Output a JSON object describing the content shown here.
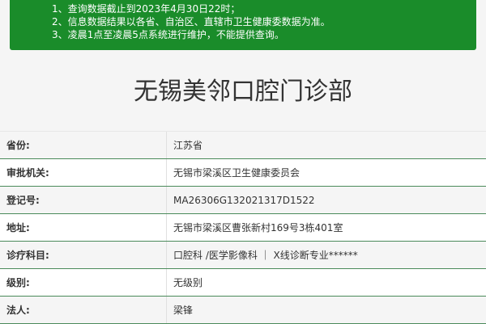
{
  "notice": {
    "lines": [
      "1、查询数据截止到2023年4月30日22时；",
      "2、信息数据结果以各省、自治区、直辖市卫生健康委数据为准。",
      "3、凌晨1点至凌晨5点系统进行维护，不能提供查询。"
    ]
  },
  "title": "无锡美邻口腔门诊部",
  "rows": [
    {
      "label": "省份:",
      "value": "江苏省"
    },
    {
      "label": "审批机关:",
      "value": "无锡市梁溪区卫生健康委员会"
    },
    {
      "label": "登记号:",
      "value": "MA26306G132021317D1522"
    },
    {
      "label": "地址:",
      "value": "无锡市梁溪区曹张新村169号3栋401室"
    },
    {
      "label": "诊疗科目:",
      "value": "口腔科 /医学影像科 ｜ X线诊断专业******"
    },
    {
      "label": "级别:",
      "value": "无级别"
    },
    {
      "label": "法人:",
      "value": "梁锋"
    }
  ]
}
